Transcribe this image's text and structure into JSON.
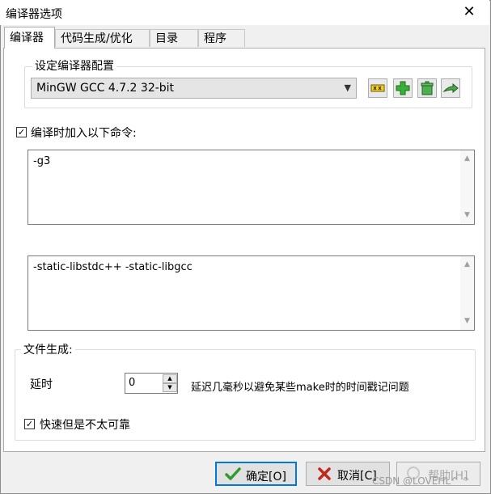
{
  "window": {
    "title": "编译器选项",
    "close_glyph": "✕"
  },
  "tabs": [
    {
      "label": "编译器",
      "active": true
    },
    {
      "label": "代码生成/优化",
      "active": false
    },
    {
      "label": "目录",
      "active": false
    },
    {
      "label": "程序",
      "active": false
    }
  ],
  "compiler_set": {
    "group_title": "设定编译器配置",
    "selected": "MinGW GCC 4.7.2 32-bit"
  },
  "compile_cmd": {
    "label": "编译时加入以下命令:",
    "checked": true,
    "value": "-g3"
  },
  "link_cmd": {
    "value": "-static-libstdc++ -static-libgcc"
  },
  "file_gen": {
    "group_title": "文件生成:",
    "delay_label": "延时",
    "delay_value": "0",
    "delay_desc": "延迟几毫秒以避免某些make时的时间戳记问题",
    "fast_label": "快速但是不太可靠",
    "fast_checked": true
  },
  "buttons": {
    "ok": "确定[O]",
    "cancel": "取消[C]",
    "help": "帮助[H]"
  },
  "watermark": "CSDN @LOVEHL^ ^",
  "colors": {
    "ok_green": "#2e9b2e",
    "cancel_red": "#c0281e",
    "focus_border": "#0078d7"
  }
}
